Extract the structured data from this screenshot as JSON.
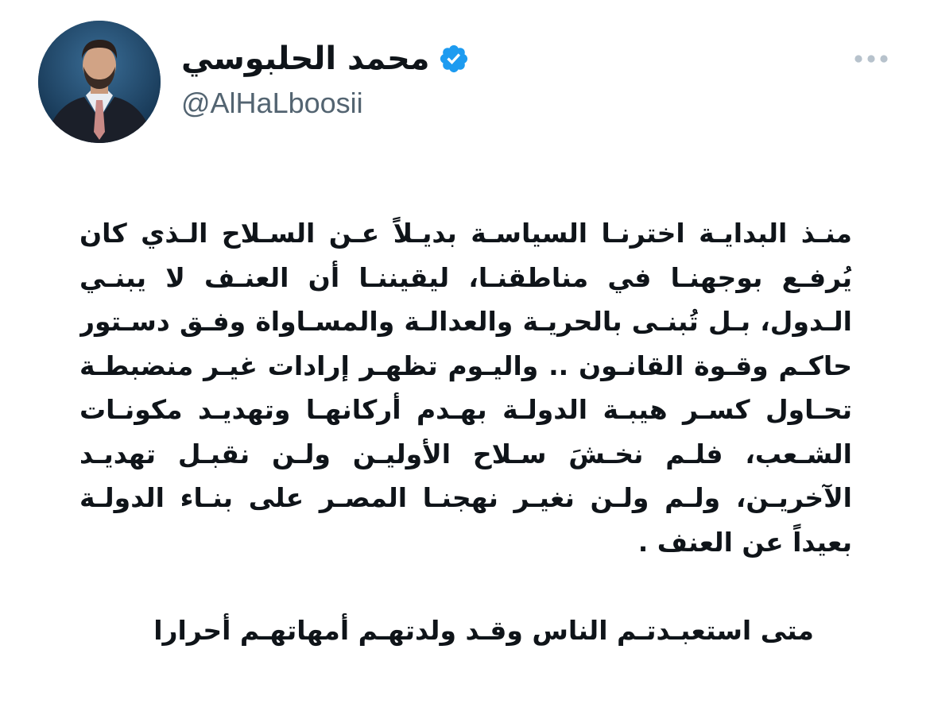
{
  "author": {
    "display_name": "محمد الحلبوسي",
    "handle": "@AlHaLboosii",
    "verified": true,
    "verified_color": "#1d9bf0"
  },
  "menu": {
    "icon": "more-horizontal-icon"
  },
  "tweet": {
    "lines": [
      "منـذ البدايـة اخترنـا السياسـة بديـلاً عـن السـلاح الـذي كان",
      "يُرفـع بوجهنـا في مناطقنـا، ليقيننـا أن العنـف لا يبنـي",
      "الـدول، بـل تُبنـى بالحريـة والعدالـة والمسـاواة وفـق دسـتور",
      "حاكـم وقـوة القانـون .. واليـوم تظهـر إرادات غيـر منضبطـة",
      "تحـاول كسـر هيبـة الدولـة بهـدم أركانهـا وتهديـد مكونـات",
      "الشـعب، فلـم نخـشَ سـلاح الأوليـن ولـن نقبـل تهديـد",
      "الآخريـن، ولـم ولـن نغيـر نهجنـا المصـر على بنـاء الدولـة",
      "بعيداً عن العنف ."
    ],
    "closing": "متى استعبـدتـم الناس وقـد ولدتهـم أمهاتهـم أحرارا"
  }
}
